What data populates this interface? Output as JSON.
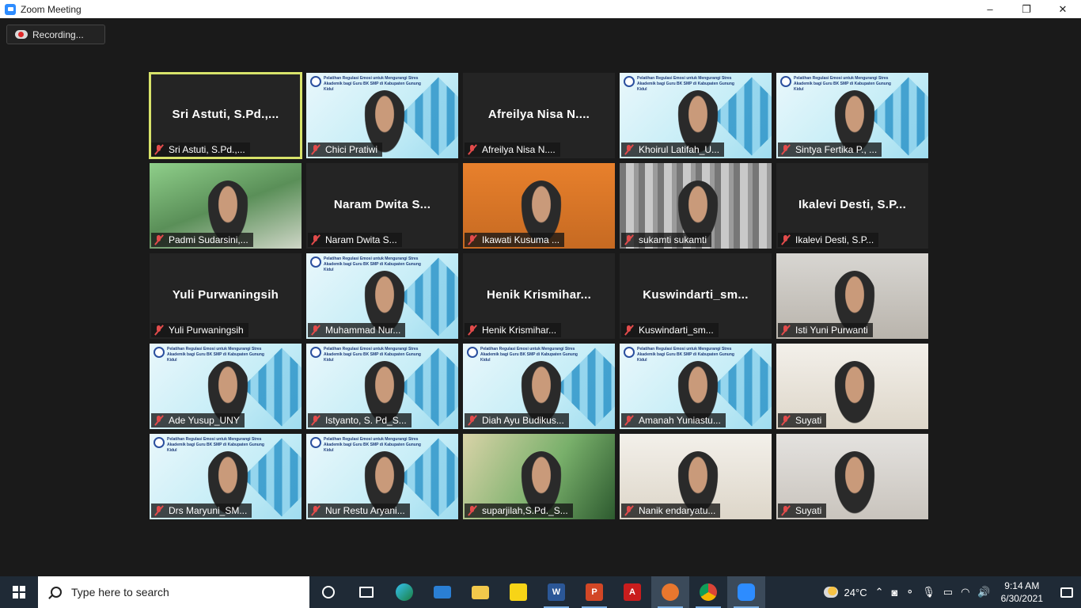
{
  "window": {
    "title": "Zoom Meeting",
    "controls": {
      "minimize": "–",
      "restore": "❐",
      "close": "✕"
    }
  },
  "recording": {
    "label": "Recording..."
  },
  "participants": [
    {
      "name": "Sri Astuti, S.Pd.,...",
      "video": false,
      "active": true
    },
    {
      "name": "Chici Pratiwi",
      "video": true
    },
    {
      "name": "Afreilya Nisa N....",
      "video": false
    },
    {
      "name": "Khoirul Latifah_U...",
      "video": true
    },
    {
      "name": "Sintya Fertika P., ...",
      "video": true
    },
    {
      "name": "Padmi Sudarsini,...",
      "video": true
    },
    {
      "name": "Naram Dwita S...",
      "video": false
    },
    {
      "name": "Ikawati Kusuma ...",
      "video": true
    },
    {
      "name": "sukamti sukamti",
      "video": true
    },
    {
      "name": "Ikalevi Desti, S.P...",
      "video": false
    },
    {
      "name": "Yuli Purwaningsih",
      "video": false
    },
    {
      "name": "Muhammad Nur...",
      "video": true
    },
    {
      "name": "Henik Krismihar...",
      "video": false
    },
    {
      "name": "Kuswindarti_sm...",
      "video": false
    },
    {
      "name": "Isti Yuni Purwanti",
      "video": true
    },
    {
      "name": "Ade Yusup_UNY",
      "video": true
    },
    {
      "name": "Istyanto, S. Pd_S...",
      "video": true
    },
    {
      "name": "Diah Ayu Budikus...",
      "video": true
    },
    {
      "name": "Amanah Yuniastu...",
      "video": true
    },
    {
      "name": "Suyati",
      "video": true
    },
    {
      "name": "Drs Maryuni_SM...",
      "video": true
    },
    {
      "name": "Nur Restu Aryani...",
      "video": true
    },
    {
      "name": "suparjilah,S.Pd._S...",
      "video": true
    },
    {
      "name": "Nanik endaryatu...",
      "video": true
    },
    {
      "name": "Suyati",
      "video": true
    }
  ],
  "slide_text": "Pelatihan Regulasi Emosi untuk Mengurangi Stres Akademik bagi Guru BK SMP di Kabupaten Gunung Kidul",
  "taskbar": {
    "search_placeholder": "Type here to search",
    "weather": "24°C",
    "time": "9:14 AM",
    "date": "6/30/2021"
  }
}
